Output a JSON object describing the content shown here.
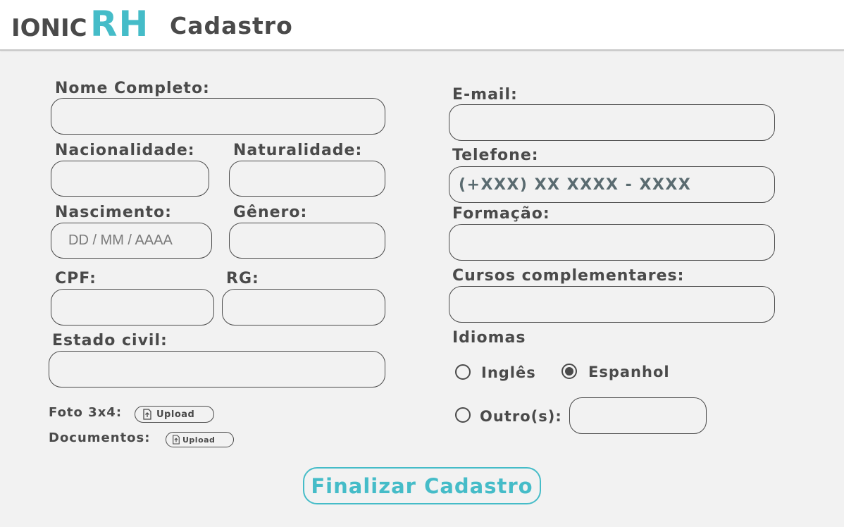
{
  "header": {
    "logo_part1": "IONIC",
    "logo_part2": "RH",
    "title": "Cadastro"
  },
  "form": {
    "nome_label": "Nome Completo:",
    "nacionalidade_label": "Nacionalidade:",
    "naturalidade_label": "Naturalidade:",
    "nascimento_label": "Nascimento:",
    "nascimento_placeholder": "DD / MM / AAAA",
    "genero_label": "Gênero:",
    "cpf_label": "CPF:",
    "rg_label": "RG:",
    "estado_civil_label": "Estado civil:",
    "foto_label": "Foto 3x4:",
    "documentos_label": "Documentos:",
    "upload_label": "Upload",
    "email_label": "E-mail:",
    "telefone_label": "Telefone:",
    "telefone_placeholder": "(+XXX) XX XXXX - XXXX",
    "formacao_label": "Formação:",
    "cursos_label": "Cursos complementares:",
    "idiomas_label": "Idiomas",
    "idiomas_options": [
      {
        "label": "Inglês",
        "checked": false
      },
      {
        "label": "Espanhol",
        "checked": true
      },
      {
        "label": "Outro(s):",
        "checked": false
      }
    ],
    "submit_label": "Finalizar Cadastro"
  },
  "colors": {
    "accent": "#45bcc8",
    "text": "#4a4a4a",
    "background": "#f2f2f2"
  },
  "icons": [
    "upload-icon",
    "upload-icon"
  ]
}
